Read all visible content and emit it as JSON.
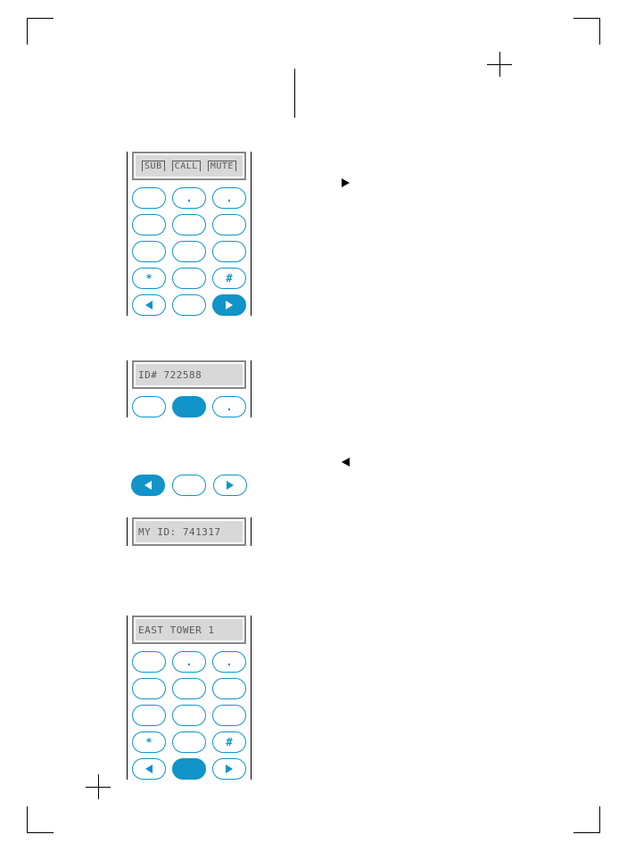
{
  "panel1": {
    "soft": {
      "left": "SUB",
      "center": "CALL",
      "right": "MUTE"
    },
    "keys": {
      "7": "",
      "8": ".",
      "9": ".",
      "4": "",
      "5": "",
      "6": "",
      "1": "",
      "2": "",
      "3": "",
      "star": "*",
      "0": "",
      "hash": "#"
    }
  },
  "panel2": {
    "display": "ID# 722588",
    "keys": {
      "a": "",
      "b": "",
      "c": "."
    }
  },
  "panel3": {
    "display": "MY ID: 741317"
  },
  "panel4": {
    "display": "EAST TOWER 1",
    "keys": {
      "7": "",
      "8": ".",
      "9": ".",
      "4": "",
      "5": "",
      "6": "",
      "1": "",
      "2": "",
      "3": "",
      "star": "*",
      "0": "",
      "hash": "#"
    }
  }
}
